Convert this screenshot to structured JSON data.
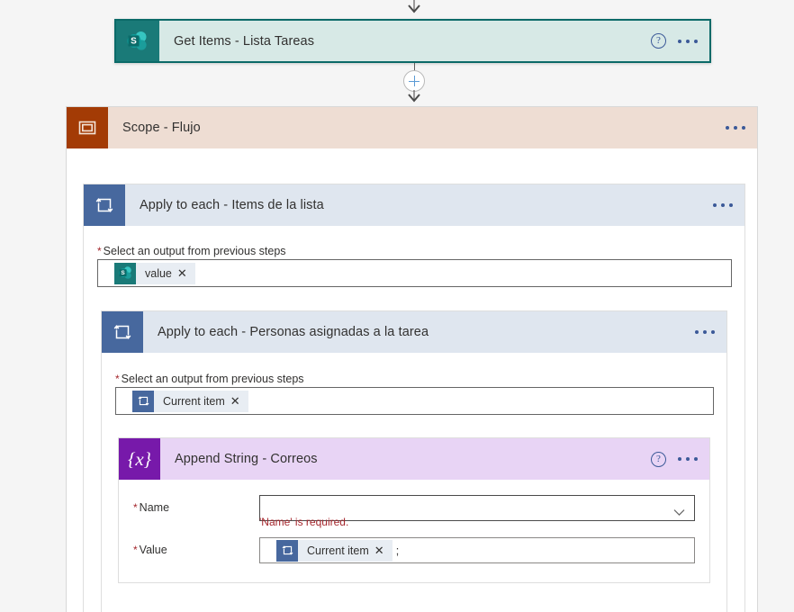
{
  "flow": {
    "get_items": {
      "title": "Get Items - Lista Tareas",
      "icon": "sharepoint-icon",
      "help_label": "?",
      "accent": "#0b6a68",
      "body_color": "#d7e9e6"
    },
    "scope": {
      "title": "Scope - Flujo",
      "icon": "scope-icon",
      "accent": "#a33b05",
      "body_color": "#eeddd3"
    },
    "apply_to_each_outer": {
      "title_main": "Apply to each",
      "title_sep": " - ",
      "title_sub": "Items de la lista",
      "title": "Apply to each - Items de la lista",
      "icon": "loop-icon",
      "accent": "#47689e",
      "body_color": "#dfe6ef",
      "field_label": "Select an output from previous steps",
      "required_marker": "*",
      "token": {
        "label": "value",
        "icon": "sharepoint-icon",
        "remove_label": "✕"
      }
    },
    "apply_to_each_inner": {
      "title": "Apply to each - Personas asignadas a la tarea",
      "icon": "loop-icon",
      "accent": "#47689e",
      "body_color": "#dfe6ef",
      "field_label": "Select an output from previous steps",
      "required_marker": "*",
      "token": {
        "label": "Current item",
        "icon": "loop-icon",
        "remove_label": "✕"
      }
    },
    "append_string": {
      "title": "Append String - Correos",
      "icon": "variable-icon",
      "icon_glyph": "{x}",
      "accent": "#7719aa",
      "body_color": "#e8d4f5",
      "help_label": "?",
      "fields": {
        "name": {
          "label": "Name",
          "required_marker": "*",
          "value": "",
          "error": "'Name' is required.",
          "control": "dropdown"
        },
        "value": {
          "label": "Value",
          "required_marker": "*",
          "token": {
            "label": "Current item",
            "icon": "loop-icon",
            "remove_label": "✕"
          },
          "trailing_text": ";"
        }
      }
    },
    "connectors": {
      "add_step_label": "+",
      "arrow": "chevron-down-arrow"
    }
  }
}
